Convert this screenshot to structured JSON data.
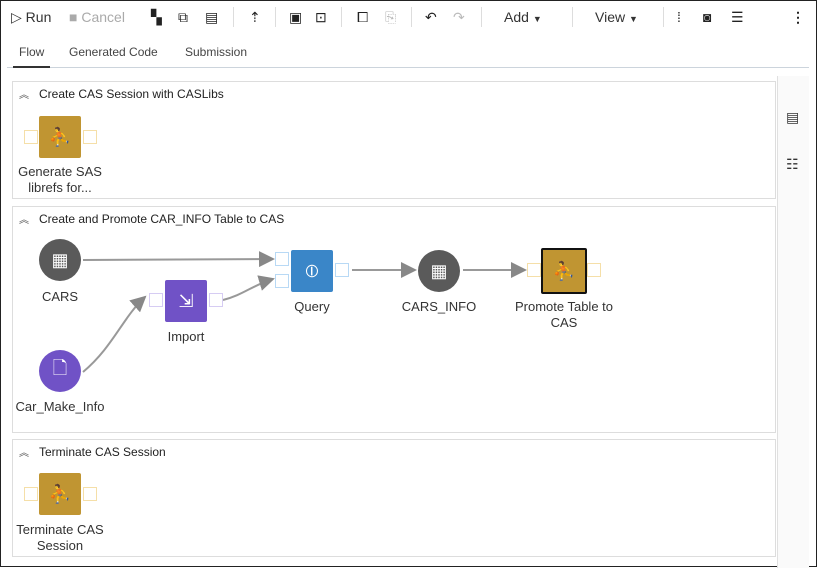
{
  "toolbar": {
    "run": "Run",
    "cancel": "Cancel",
    "add": "Add",
    "view": "View"
  },
  "tabs": [
    "Flow",
    "Generated Code",
    "Submission"
  ],
  "sections": [
    {
      "title": "Create CAS Session with CASLibs",
      "nodes": [
        {
          "label": "Generate SAS librefs for..."
        }
      ]
    },
    {
      "title": "Create and Promote CAR_INFO Table to CAS",
      "nodes": [
        {
          "label": "CARS"
        },
        {
          "label": "Car_Make_Info"
        },
        {
          "label": "Import"
        },
        {
          "label": "Query"
        },
        {
          "label": "CARS_INFO"
        },
        {
          "label": "Promote Table to CAS"
        }
      ]
    },
    {
      "title": "Terminate CAS Session",
      "nodes": [
        {
          "label": "Terminate CAS Session"
        }
      ]
    }
  ],
  "colors": {
    "table": "#5a5a5a",
    "file": "#7052c6",
    "import": "#7052c6",
    "query": "#3a86c8",
    "code": "#c09532"
  }
}
